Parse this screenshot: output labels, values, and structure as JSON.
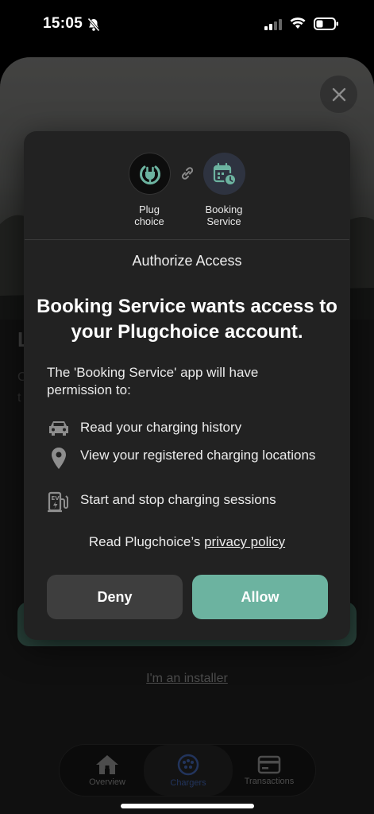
{
  "status_bar": {
    "time": "15:05"
  },
  "background": {
    "partial_heading": "L",
    "partial_line1": "C",
    "partial_line2": "t",
    "installer_link": "I'm an installer"
  },
  "tabs": [
    {
      "label": "Overview",
      "icon": "home-icon"
    },
    {
      "label": "Chargers",
      "icon": "charger-plug-icon",
      "active": true
    },
    {
      "label": "Transactions",
      "icon": "card-icon"
    }
  ],
  "dialog": {
    "apps": {
      "source": {
        "label_line1": "Plug",
        "label_line2": "choice",
        "icon": "plug-logo-icon"
      },
      "target": {
        "label_line1": "Booking",
        "label_line2": "Service",
        "icon": "calendar-clock-icon"
      }
    },
    "title": "Authorize Access",
    "headline": "Booking Service wants access to your Plugchoice account.",
    "intro": "The 'Booking Service' app will have permission to:",
    "permissions": [
      {
        "icon": "car-icon",
        "text": "Read your charging history"
      },
      {
        "icon": "location-pin-icon",
        "text": "View your registered charging locations"
      },
      {
        "icon": "ev-charger-icon",
        "text": "Start and stop charging sessions"
      }
    ],
    "privacy_prefix": "Read Plugchoice’s",
    "privacy_link": "privacy policy",
    "deny_label": "Deny",
    "allow_label": "Allow"
  },
  "colors": {
    "accent": "#6cb3a0",
    "active_tab": "#3f5fa8",
    "modal_bg": "#222222"
  }
}
